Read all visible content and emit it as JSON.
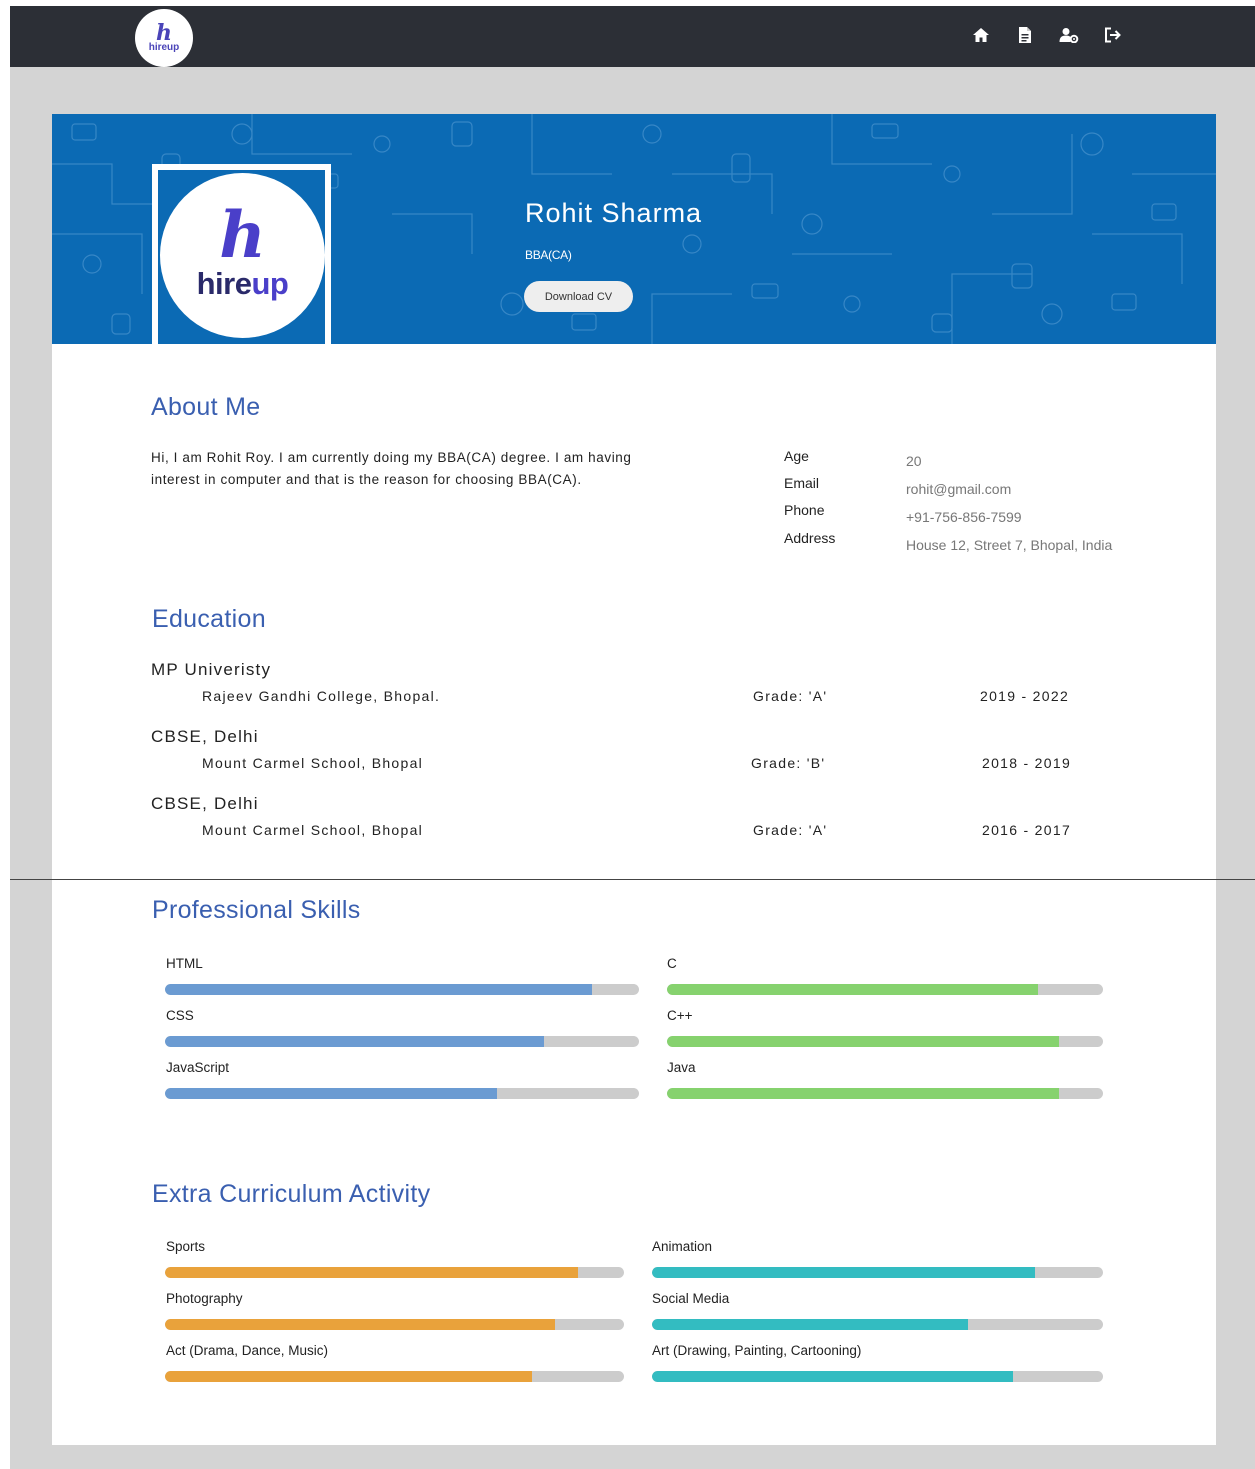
{
  "nav": {
    "logo_mark": "h",
    "logo_word": "hireup",
    "icons": [
      "home-icon",
      "document-icon",
      "user-settings-icon",
      "logout-icon"
    ]
  },
  "profile": {
    "logo_mark": "h",
    "logo_word_a": "hire",
    "logo_word_b": "up",
    "name": "Rohit Sharma",
    "degree": "BBA(CA)",
    "download_label": "Download CV"
  },
  "about": {
    "title": "About Me",
    "text": "Hi, I am Rohit Roy. I am currently doing my BBA(CA) degree. I am having interest in computer and that is the reason for choosing BBA(CA).",
    "info": [
      {
        "label": "Age",
        "value": "20"
      },
      {
        "label": "Email",
        "value": "rohit@gmail.com"
      },
      {
        "label": "Phone",
        "value": "+91-756-856-7599"
      },
      {
        "label": "Address",
        "value": "House 12, Street 7, Bhopal, India"
      }
    ]
  },
  "education": {
    "title": "Education",
    "items": [
      {
        "institution": "MP Univeristy",
        "school": "Rajeev Gandhi College, Bhopal.",
        "grade": "Grade: 'A'",
        "years": "2019 - 2022"
      },
      {
        "institution": "CBSE, Delhi",
        "school": "Mount Carmel School, Bhopal",
        "grade": "Grade: 'B'",
        "years": "2018 - 2019"
      },
      {
        "institution": "CBSE, Delhi",
        "school": "Mount Carmel School, Bhopal",
        "grade": "Grade: 'A'",
        "years": "2016 - 2017"
      }
    ]
  },
  "skills": {
    "title": "Professional Skills",
    "left": [
      {
        "name": "HTML",
        "level": 0.9
      },
      {
        "name": "CSS",
        "level": 0.8
      },
      {
        "name": "JavaScript",
        "level": 0.7
      }
    ],
    "right": [
      {
        "name": "C",
        "level": 0.85
      },
      {
        "name": "C++",
        "level": 0.9
      },
      {
        "name": "Java",
        "level": 0.9
      }
    ],
    "left_color": "#6b9bd2",
    "right_color": "#86d26e"
  },
  "extra": {
    "title": "Extra Curriculum Activity",
    "left": [
      {
        "name": "Sports",
        "level": 0.9
      },
      {
        "name": "Photography",
        "level": 0.85
      },
      {
        "name": "Act (Drama, Dance, Music)",
        "level": 0.8
      }
    ],
    "right": [
      {
        "name": "Animation",
        "level": 0.85
      },
      {
        "name": "Social Media",
        "level": 0.7
      },
      {
        "name": "Art (Drawing, Painting, Cartooning)",
        "level": 0.8
      }
    ],
    "left_color": "#e9a23b",
    "right_color": "#33bcc1"
  },
  "colors": {
    "nav_bg": "#2c2f36",
    "banner": "#0b6ab4",
    "heading": "#3a5fb0",
    "page_bg": "#d4d4d4"
  }
}
